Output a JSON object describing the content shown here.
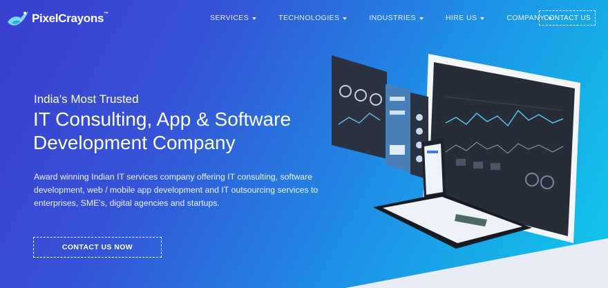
{
  "brand": {
    "name": "PixelCrayons",
    "trademark": "™"
  },
  "nav": {
    "items": [
      {
        "label": "SERVICES"
      },
      {
        "label": "TECHNOLOGIES"
      },
      {
        "label": "INDUSTRIES"
      },
      {
        "label": "HIRE US"
      },
      {
        "label": "COMPANY"
      }
    ],
    "contact_label": "CONTACT US"
  },
  "hero": {
    "eyebrow": "India's Most Trusted",
    "headline_line1": "IT Consulting, App & Software",
    "headline_line2": "Development Company",
    "description": "Award winning Indian IT services company offering IT consulting, software development, web / mobile app development and IT outsourcing services to enterprises, SME's, digital agencies and startups.",
    "cta_label": "CONTACT US NOW"
  },
  "colors": {
    "gradient_start": "#3a3fcf",
    "gradient_end": "#0fc9ea",
    "dashboard_dark": "#2a3140",
    "bottom_band": "#e9ecf5"
  },
  "icons": [
    "logo-bird-icon",
    "caret-down-icon"
  ]
}
